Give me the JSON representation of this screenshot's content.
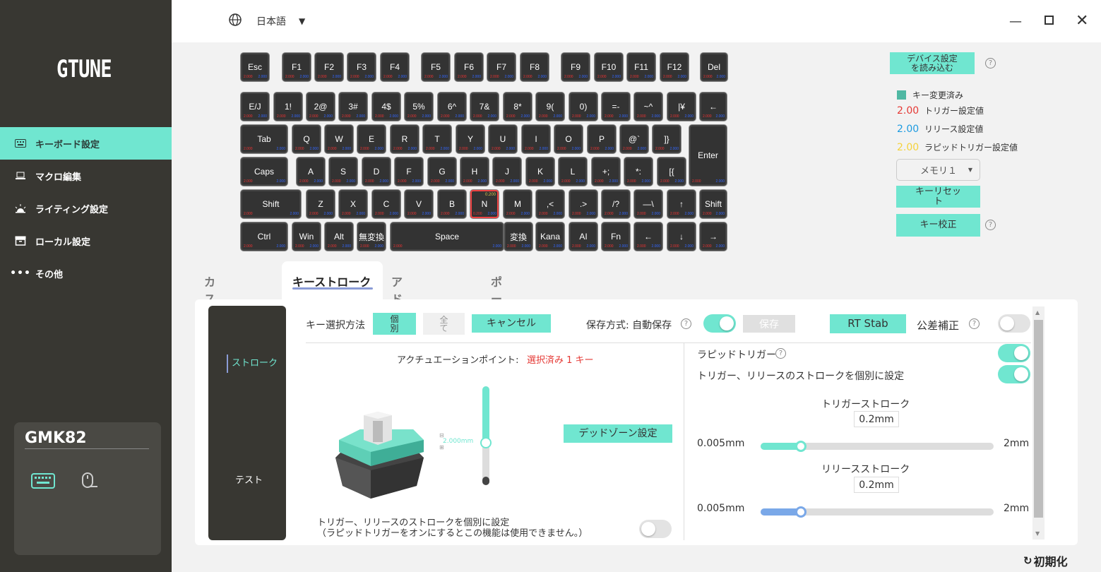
{
  "sidebar": {
    "logo": "GTUNE",
    "items": [
      {
        "label": "キーボード設定"
      },
      {
        "label": "マクロ編集"
      },
      {
        "label": "ライティング設定"
      },
      {
        "label": "ローカル設定"
      },
      {
        "label": "その他"
      }
    ],
    "device_name": "GMK82"
  },
  "topbar": {
    "language": "日本語"
  },
  "keyboard": {
    "default_trigger": "2.000",
    "default_release": "2.000",
    "selected_key_values": {
      "top": "0.200",
      "bottom": "0.200"
    },
    "rows": [
      [
        "Esc",
        "F1",
        "F2",
        "F3",
        "F4",
        "F5",
        "F6",
        "F7",
        "F8",
        "F9",
        "F10",
        "F11",
        "F12",
        "Del"
      ],
      [
        "E/J",
        "1!",
        "2@",
        "3#",
        "4$",
        "5%",
        "6^",
        "7&",
        "8*",
        "9(",
        "0)",
        "=-",
        "~^",
        "|¥",
        "←"
      ],
      [
        "Tab",
        "Q",
        "W",
        "E",
        "R",
        "T",
        "Y",
        "U",
        "I",
        "O",
        "P",
        "@`",
        "]}",
        "Enter"
      ],
      [
        "Caps",
        "A",
        "S",
        "D",
        "F",
        "G",
        "H",
        "J",
        "K",
        "L",
        "+;",
        "*:",
        "[{"
      ],
      [
        "Shift",
        "Z",
        "X",
        "C",
        "V",
        "B",
        "N",
        "M",
        ",<",
        ".>",
        "/?",
        "—\\",
        "↑",
        "Shift"
      ],
      [
        "Ctrl",
        "Win",
        "Alt",
        "無変換",
        "Space",
        "変換",
        "Kana",
        "AI",
        "Fn",
        "←",
        "↓",
        "→"
      ]
    ]
  },
  "right_panel": {
    "load_device_button": "デバイス設定\nを読み込む",
    "legend": [
      {
        "value": "",
        "label": "キー変更済み",
        "color": "#4fb8a3"
      },
      {
        "value": "2.00",
        "label": "トリガー設定値",
        "color": "#e53935"
      },
      {
        "value": "2.00",
        "label": "リリース設定値",
        "color": "#1e9be0"
      },
      {
        "value": "2.00",
        "label": "ラピッドトリガー設定値",
        "color": "#f5d23b"
      }
    ],
    "memory_select": "メモリ１",
    "key_reset_button": "キーリセッ\nト",
    "key_calibration_button": "キー校正"
  },
  "tabs": [
    "カスタムキー",
    "キーストローク",
    "アドバンスキー",
    "ポーリングレート"
  ],
  "active_tab": "キーストローク",
  "subnav": {
    "stroke": "ストローク",
    "test": "テスト"
  },
  "toolbar": {
    "select_method_label": "キー選択方法",
    "individual": "個\n別",
    "all": "全\nて",
    "cancel": "キャンセル",
    "save_mode_label": "保存方式: 自動保存",
    "save": "保存",
    "rt_stab": "RT Stab",
    "tolerance": "公差補正"
  },
  "actuation": {
    "label": "アクチュエーションポイント:",
    "selected": "選択済み 1 キー",
    "value": "2.000mm",
    "deadzone_button": "デッドゾーン設定",
    "separate_label": "トリガー、リリースのストロークを個別に設定",
    "separate_note": "（ラピッドトリガーをオンにするとこの機能は使用できません。）"
  },
  "rapid": {
    "rapid_trigger_label": "ラピッドトリガー",
    "separate_label": "トリガー、リリースのストロークを個別に設定",
    "trigger_stroke_label": "トリガーストローク",
    "trigger_stroke_value": "0.2mm",
    "release_stroke_label": "リリースストローク",
    "release_stroke_value": "0.2mm",
    "min": "0.005mm",
    "max": "2mm",
    "trigger_fraction": 0.1,
    "release_fraction": 0.1
  },
  "footer": {
    "reset_label": "初期化"
  }
}
